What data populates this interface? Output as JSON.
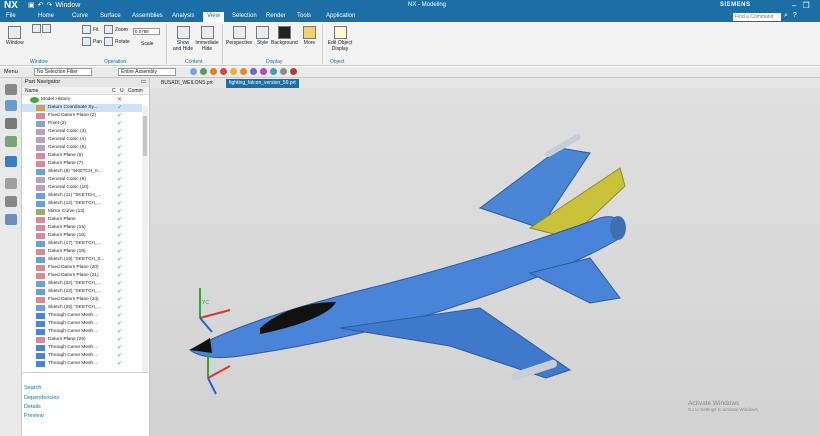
{
  "titlebar": {
    "logo": "NX",
    "window_menu": "Window",
    "window_title": "NX - Modeling",
    "brand": "SIEMENS"
  },
  "menu": {
    "tabs": [
      "File",
      "Home",
      "Curve",
      "Surface",
      "Assemblies",
      "Analysis",
      "View",
      "Selection",
      "Render",
      "Tools",
      "Application"
    ],
    "active": "View",
    "find_command": "Find a Command"
  },
  "ribbon": {
    "buttons": [
      {
        "label": "Window",
        "icon": "window-icon"
      },
      {
        "label": "Fit",
        "icon": "fit-icon"
      },
      {
        "label": "Pan",
        "icon": "pan-icon"
      },
      {
        "label": "Zoom",
        "icon": "zoom-icon"
      },
      {
        "label": "Rotate",
        "icon": "rotate-icon"
      },
      {
        "label": "Scale",
        "icon": "scale-icon"
      },
      {
        "label": "Show and Hide",
        "icon": "show-hide-icon"
      },
      {
        "label": "Immediate Hide",
        "icon": "immediate-hide-icon"
      },
      {
        "label": "Perspective",
        "icon": "perspective-icon"
      },
      {
        "label": "Style",
        "icon": "style-icon"
      },
      {
        "label": "Background",
        "icon": "background-icon"
      },
      {
        "label": "More",
        "icon": "more-icon"
      },
      {
        "label": "Edit Object Display",
        "icon": "edit-object-display-icon"
      }
    ],
    "zoom_value": "0.0788",
    "groups": [
      "Window",
      "Operation",
      "Content",
      "Display",
      "Object"
    ]
  },
  "selection_bar": {
    "menu": "Menu",
    "filter": "No Selection Filter",
    "scope": "Entire Assembly"
  },
  "navigator": {
    "title": "Part Navigator",
    "columns": [
      "Name",
      "C",
      "U",
      "Comm"
    ],
    "root": "Model History",
    "items": [
      "Datum Coordinate Sy...",
      "Fixed Datum Plane (2)",
      "Point (2)",
      "General Conic (3)",
      "General Conic (4)",
      "General Conic (5)",
      "Datum Plane (6)",
      "Datum Plane (7)",
      "Sketch (8) \"SKETCH_0...",
      "General Conic (9)",
      "General Conic (10)",
      "Sketch (11) \"SKETCH_...",
      "Sketch (12) \"SKETCH_...",
      "Mirror Curve (13)",
      "Datum Plane",
      "Datum Plane (15)",
      "Datum Plane (16)",
      "Sketch (17) \"SKETCH_...",
      "Datum Plane (18)",
      "Sketch (19) \"SKETCH_0...",
      "Fixed Datum Plane (20)",
      "Fixed Datum Plane (21)",
      "Sketch (22) \"SKETCH_...",
      "Sketch (23) \"SKETCH_...",
      "Fixed Datum Plane (24)",
      "Sketch (25) \"SKETCH_...",
      "Through Curve Mesh ...",
      "Through Curve Mesh ...",
      "Through Curve Mesh ...",
      "Datum Plane (29)",
      "Through Curve Mesh ...",
      "Through Curve Mesh ...",
      "Through Curve Mesh ..."
    ],
    "sections": [
      "Search",
      "Dependencies",
      "Details",
      "Preview"
    ]
  },
  "file_tabs": [
    "BUSADI_WEILONS.prt",
    "fighting_falcon_version_59.prt"
  ],
  "active_file_tab": "fighting_falcon_version_59.prt",
  "activation": {
    "line1": "Activate Windows",
    "line2": "Go to Settings to activate Windows."
  },
  "colors": {
    "brand_blue": "#1c6fa6",
    "jet_blue": "#4a84d8",
    "tail_yellow": "#c9c23a"
  }
}
